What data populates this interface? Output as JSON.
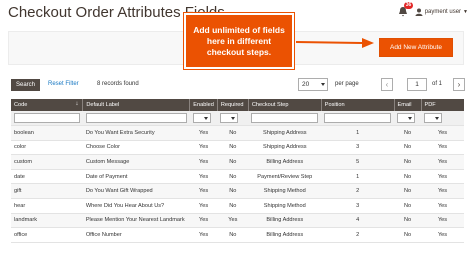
{
  "header": {
    "title": "Checkout Order Attributes Fields",
    "notifications_count": "36",
    "user_name": "payment user"
  },
  "actions": {
    "add_button_label": "Add New Attribute"
  },
  "callout": {
    "text": "Add unlimited of fields here in different checkout steps."
  },
  "toolbar": {
    "search_label": "Search",
    "reset_label": "Reset Filter",
    "records_found": "8 records found",
    "per_page_value": "20",
    "per_page_label": "per page",
    "page_value": "1",
    "of_label": "of 1"
  },
  "grid": {
    "columns": [
      "Code",
      "Default Label",
      "Enabled",
      "Required",
      "Checkout Step",
      "Position",
      "Email",
      "PDF"
    ],
    "rows": [
      [
        "boolean",
        "Do You Want Extra Security",
        "Yes",
        "No",
        "Shipping Address",
        "1",
        "No",
        "Yes"
      ],
      [
        "color",
        "Choose Color",
        "Yes",
        "No",
        "Shipping Address",
        "3",
        "No",
        "Yes"
      ],
      [
        "custom",
        "Custom Message",
        "Yes",
        "No",
        "Billing Address",
        "5",
        "No",
        "Yes"
      ],
      [
        "date",
        "Date of Payment",
        "Yes",
        "No",
        "Payment/Review Step",
        "1",
        "No",
        "Yes"
      ],
      [
        "gift",
        "Do You Want Gift Wrapped",
        "Yes",
        "No",
        "Shipping Method",
        "2",
        "No",
        "Yes"
      ],
      [
        "hear",
        "Where Did You Hear About Us?",
        "Yes",
        "No",
        "Shipping Method",
        "3",
        "No",
        "Yes"
      ],
      [
        "landmark",
        "Please Mention Your Nearest Landmark",
        "Yes",
        "Yes",
        "Billing Address",
        "4",
        "No",
        "Yes"
      ],
      [
        "office",
        "Office Number",
        "Yes",
        "No",
        "Billing Address",
        "2",
        "No",
        "Yes"
      ]
    ]
  },
  "colors": {
    "accent": "#eb5202",
    "header_bg": "#514943",
    "link": "#1979c3"
  }
}
